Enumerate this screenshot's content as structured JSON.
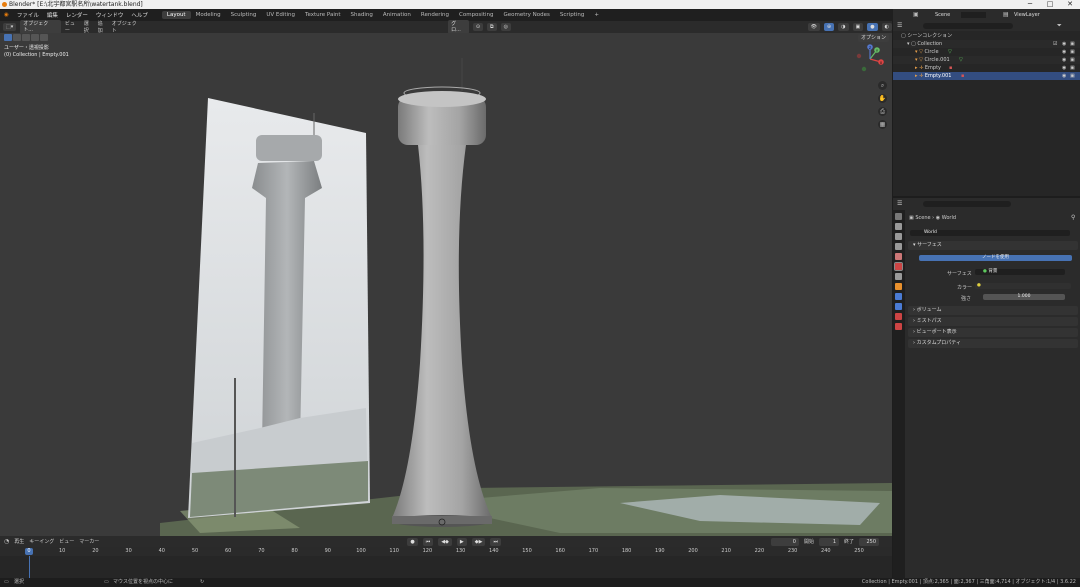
{
  "window": {
    "title": "Blender* [E:\\北宇都宮駅名所\\watertank.blend]"
  },
  "menubar": {
    "menus": [
      "ファイル",
      "編集",
      "レンダー",
      "ウィンドウ",
      "ヘルプ"
    ],
    "workspaces": [
      "Layout",
      "Modeling",
      "Sculpting",
      "UV Editing",
      "Texture Paint",
      "Shading",
      "Animation",
      "Rendering",
      "Compositing",
      "Geometry Nodes",
      "Scripting"
    ],
    "add_tab": "+",
    "scene_label": "Scene",
    "viewlayer_label": "ViewLayer"
  },
  "viewport_header": {
    "mode": "オブジェクト...",
    "menus": [
      "ビュー",
      "選択",
      "追加",
      "オブジェクト"
    ],
    "transform": "グロ...",
    "options": "オプション"
  },
  "viewport": {
    "view_name": "ユーザー・透視投影",
    "context": "(0) Collection | Empty.001"
  },
  "gizmo": {
    "x": "X",
    "y": "Y",
    "z": "Z"
  },
  "outliner": {
    "root": "シーンコレクション",
    "collection": "Collection",
    "items": [
      {
        "name": "Circle",
        "selected": false
      },
      {
        "name": "Circle.001",
        "selected": false
      },
      {
        "name": "Empty",
        "selected": false
      },
      {
        "name": "Empty.001",
        "selected": true
      }
    ]
  },
  "properties": {
    "breadcrumb_scene": "Scene",
    "breadcrumb_world": "World",
    "world_name": "World",
    "surface_panel": "サーフェス",
    "use_nodes_button": "ノードを使用",
    "surface_label": "サーフェス",
    "surface_value": "背景",
    "color_label": "カラー",
    "strength_label": "強さ",
    "strength_value": "1.000",
    "panels": [
      "ボリューム",
      "ミストパス",
      "ビューポート表示",
      "カスタムプロパティ"
    ]
  },
  "timeline": {
    "menus": [
      "再生",
      "キーイング",
      "ビュー",
      "マーカー"
    ],
    "current_frame": "0",
    "start_label": "開始",
    "start_value": "1",
    "end_label": "終了",
    "end_value": "250",
    "ticks": [
      0,
      10,
      20,
      30,
      40,
      50,
      60,
      70,
      80,
      90,
      100,
      110,
      120,
      130,
      140,
      150,
      160,
      170,
      180,
      190,
      200,
      210,
      220,
      230,
      240,
      250
    ]
  },
  "statusbar": {
    "left": "選択",
    "middle": "マウス位置を視点の中心に",
    "right": "Collection | Empty.001 | 頂点:2,365 | 面:2,367 | 三角面:4,714 | オブジェクト:1/4 | 3.6.22"
  },
  "colors": {
    "accent": "#4772b3",
    "selection": "#334d80",
    "viewport_bg": "#3a3a3a",
    "blender_orange": "#e87d0d"
  }
}
